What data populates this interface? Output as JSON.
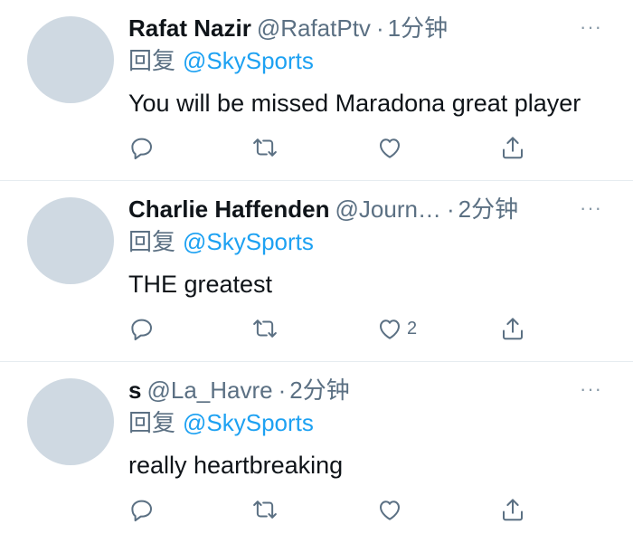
{
  "tweets": [
    {
      "name": "Rafat Nazir",
      "handle": "@RafatPtv",
      "separator": "·",
      "time": "1分钟",
      "more": "···",
      "reply_prefix": "回复",
      "reply_mention": "@SkySports",
      "text": "You will be missed Maradona great player",
      "like_count": ""
    },
    {
      "name": "Charlie Haffenden",
      "handle": "@Journ…",
      "separator": "·",
      "time": "2分钟",
      "more": "···",
      "reply_prefix": "回复",
      "reply_mention": "@SkySports",
      "text": "THE greatest",
      "like_count": "2"
    },
    {
      "name": "s",
      "handle": "@La_Havre",
      "separator": "·",
      "time": "2分钟",
      "more": "···",
      "reply_prefix": "回复",
      "reply_mention": "@SkySports",
      "text": "really heartbreaking",
      "like_count": ""
    }
  ],
  "icons": {
    "reply": "reply-icon",
    "retweet": "retweet-icon",
    "like": "like-icon",
    "share": "share-icon",
    "more": "more-icon"
  },
  "colors": {
    "accent": "#1da1f2",
    "secondary_text": "#5b7083",
    "icon": "#5b7083",
    "avatar_placeholder": "#cfd9e2",
    "divider": "#e6ecf0"
  }
}
